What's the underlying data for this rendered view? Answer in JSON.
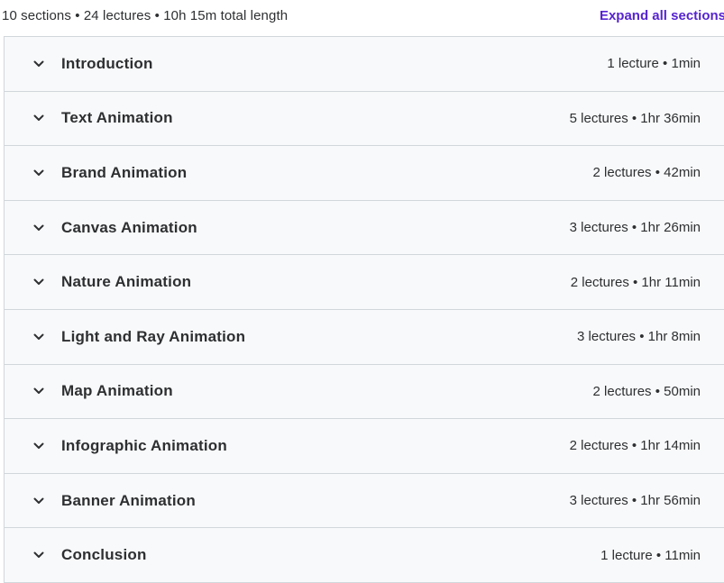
{
  "summary": {
    "text": "10 sections • 24 lectures • 10h 15m total length",
    "expand_label": "Expand all sections"
  },
  "sections": [
    {
      "title": "Introduction",
      "meta": "1 lecture • 1min"
    },
    {
      "title": "Text Animation",
      "meta": "5 lectures • 1hr 36min"
    },
    {
      "title": "Brand Animation",
      "meta": "2 lectures • 42min"
    },
    {
      "title": "Canvas Animation",
      "meta": "3 lectures • 1hr 26min"
    },
    {
      "title": "Nature Animation",
      "meta": "2 lectures • 1hr 11min"
    },
    {
      "title": "Light and Ray Animation",
      "meta": "3 lectures • 1hr 8min"
    },
    {
      "title": "Map Animation",
      "meta": "2 lectures • 50min"
    },
    {
      "title": "Infographic Animation",
      "meta": "2 lectures • 1hr 14min"
    },
    {
      "title": "Banner Animation",
      "meta": "3 lectures • 1hr 56min"
    },
    {
      "title": "Conclusion",
      "meta": "1 lecture • 11min"
    }
  ],
  "icons": {
    "section_toggle": "chevron-down-icon"
  },
  "colors": {
    "accent": "#5624d0",
    "text": "#2d2f31",
    "row_background": "#f7f9fa",
    "border": "#d1d7dc"
  }
}
